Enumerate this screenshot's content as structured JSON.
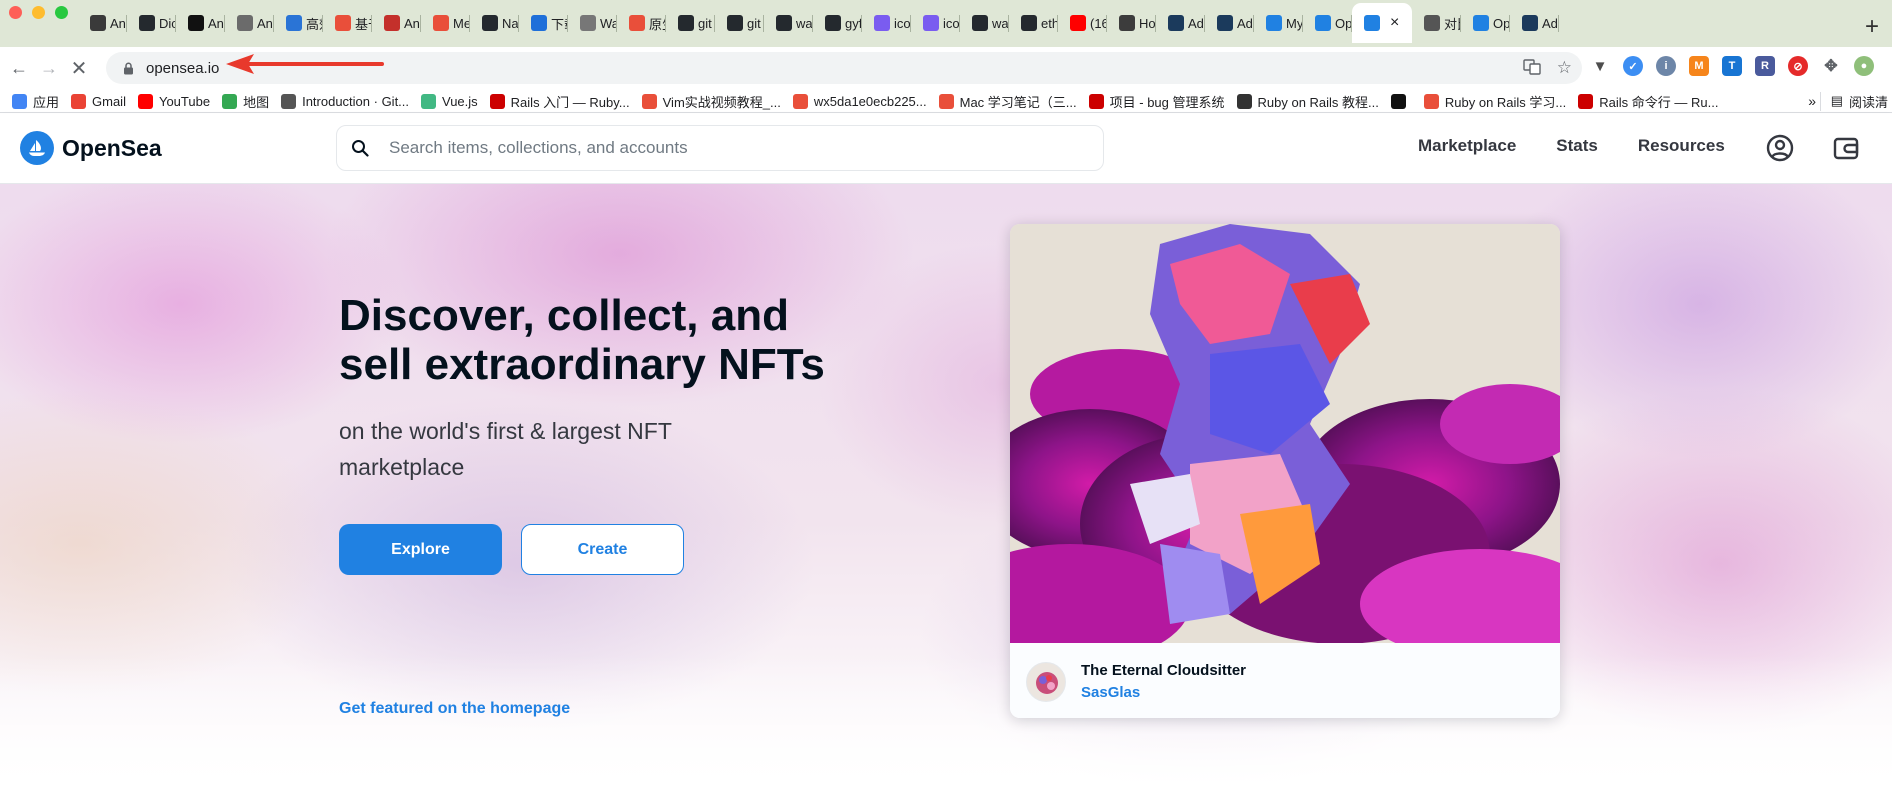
{
  "browser": {
    "tabs": [
      {
        "label": "Anc",
        "icon": "app-favicon",
        "color": "#3a3a3a"
      },
      {
        "label": "Dic",
        "icon": "github-icon",
        "color": "#24292e"
      },
      {
        "label": "Anc",
        "icon": "notion-icon",
        "color": "#111111"
      },
      {
        "label": "Anc",
        "icon": "vue-icon",
        "color": "#6b6b6b"
      },
      {
        "label": "高效",
        "icon": "app-favicon",
        "color": "#2a74d6"
      },
      {
        "label": "基于",
        "icon": "app-favicon",
        "color": "#e94f3a"
      },
      {
        "label": "Anc",
        "icon": "app-favicon",
        "color": "#c4302b"
      },
      {
        "label": "Me",
        "icon": "app-favicon",
        "color": "#e94f3a"
      },
      {
        "label": "Nar",
        "icon": "github-icon",
        "color": "#24292e"
      },
      {
        "label": "下载",
        "icon": "app-favicon",
        "color": "#1e6fd9"
      },
      {
        "label": "Wa",
        "icon": "app-favicon",
        "color": "#777777"
      },
      {
        "label": "原生",
        "icon": "app-favicon",
        "color": "#e94f3a"
      },
      {
        "label": "git",
        "icon": "github-icon",
        "color": "#24292e"
      },
      {
        "label": "git",
        "icon": "github-icon",
        "color": "#24292e"
      },
      {
        "label": "wa",
        "icon": "github-icon",
        "color": "#24292e"
      },
      {
        "label": "gyf",
        "icon": "github-icon",
        "color": "#24292e"
      },
      {
        "label": "ico",
        "icon": "app-favicon",
        "color": "#7a5cf0"
      },
      {
        "label": "ico",
        "icon": "app-favicon",
        "color": "#7a5cf0"
      },
      {
        "label": "wa",
        "icon": "github-icon",
        "color": "#24292e"
      },
      {
        "label": "eth",
        "icon": "github-icon",
        "color": "#24292e"
      },
      {
        "label": "(16",
        "icon": "youtube-icon",
        "color": "#ff0000"
      },
      {
        "label": "Ho",
        "icon": "app-favicon",
        "color": "#3c3c3c"
      },
      {
        "label": "Adi",
        "icon": "app-favicon",
        "color": "#1b3a5c"
      },
      {
        "label": "Adi",
        "icon": "app-favicon",
        "color": "#1b3a5c"
      },
      {
        "label": "My",
        "icon": "opensea-icon",
        "color": "#2081e2"
      },
      {
        "label": "Op",
        "icon": "opensea-icon",
        "color": "#2081e2"
      },
      {
        "label": "",
        "icon": "loading-icon",
        "color": "#2081e2",
        "active": true
      },
      {
        "label": "对比",
        "icon": "app-favicon",
        "color": "#555555"
      },
      {
        "label": "Op",
        "icon": "opensea-icon",
        "color": "#2081e2"
      },
      {
        "label": "Adi",
        "icon": "app-favicon",
        "color": "#1b3a5c"
      }
    ],
    "url": "opensea.io",
    "bookmarks": [
      {
        "label": "应用",
        "color": "#4285f4"
      },
      {
        "label": "Gmail",
        "color": "#ea4335"
      },
      {
        "label": "YouTube",
        "color": "#ff0000"
      },
      {
        "label": "地图",
        "color": "#34a853"
      },
      {
        "label": "Introduction · Git...",
        "color": "#555555"
      },
      {
        "label": "Vue.js",
        "color": "#41b883"
      },
      {
        "label": "Rails 入门 — Ruby...",
        "color": "#cc0000"
      },
      {
        "label": "Vim实战视频教程_...",
        "color": "#e94f3a"
      },
      {
        "label": "wx5da1e0ecb225...",
        "color": "#e94f3a"
      },
      {
        "label": "Mac 学习笔记（三...",
        "color": "#e94f3a"
      },
      {
        "label": "项目 - bug 管理系统",
        "color": "#cc0000"
      },
      {
        "label": "Ruby on Rails 教程...",
        "color": "#333333"
      },
      {
        "label": "",
        "color": "#111111"
      },
      {
        "label": "Ruby on Rails 学习...",
        "color": "#e94f3a"
      },
      {
        "label": "Rails 命令行 — Ru...",
        "color": "#cc0000"
      }
    ],
    "more_label": "»",
    "reading_list_label": "阅读清"
  },
  "opensea": {
    "logo_text": "OpenSea",
    "search_placeholder": "Search items, collections, and accounts",
    "nav_links": [
      "Marketplace",
      "Stats",
      "Resources"
    ],
    "headline": "Discover, collect, and sell extraordinary NFTs",
    "subheadline": "on the world's first & largest NFT marketplace",
    "explore_label": "Explore",
    "create_label": "Create",
    "featured_link": "Get featured on the homepage",
    "card": {
      "title": "The Eternal Cloudsitter",
      "artist": "SasGlas"
    },
    "accent_color": "#2081e2"
  }
}
